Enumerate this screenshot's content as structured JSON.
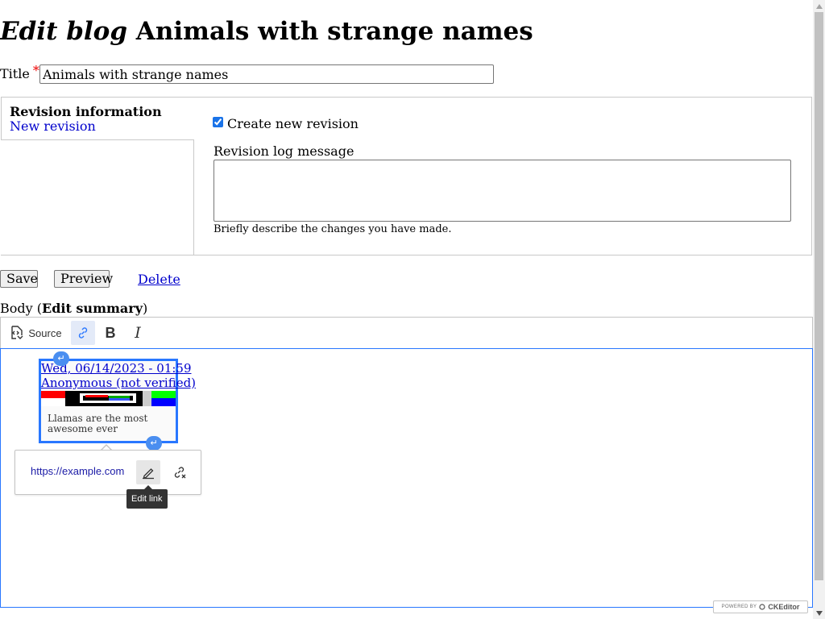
{
  "header": {
    "title_prefix": "Edit blog",
    "title_name": "Animals with strange names"
  },
  "title_field": {
    "label": "Title",
    "required_mark": "*",
    "value": "Animals with strange names"
  },
  "revision": {
    "tab_title": "Revision information",
    "tab_link": "New revision",
    "checkbox_label": "Create new revision",
    "checkbox_checked": true,
    "log_label": "Revision log message",
    "log_description": "Briefly describe the changes you have made."
  },
  "actions": {
    "save": "Save",
    "preview": "Preview",
    "delete": "Delete"
  },
  "body": {
    "label_prefix": "Body (",
    "summary_link": "Edit summary",
    "label_suffix": ")"
  },
  "toolbar": {
    "source_label": "Source"
  },
  "widget": {
    "date": "Wed, 06/14/2023 - 01:59",
    "author": "Anonymous (not verified)",
    "text": "Llamas are the most awesome ever"
  },
  "link_balloon": {
    "url": "https://example.com",
    "tooltip": "Edit link"
  },
  "powered_by": {
    "prefix": "POWERED BY",
    "brand": "CKEditor"
  },
  "colors": {
    "focus_blue": "#2977ff",
    "link_blue": "#0000cc",
    "tooltip_bg": "#333333"
  }
}
